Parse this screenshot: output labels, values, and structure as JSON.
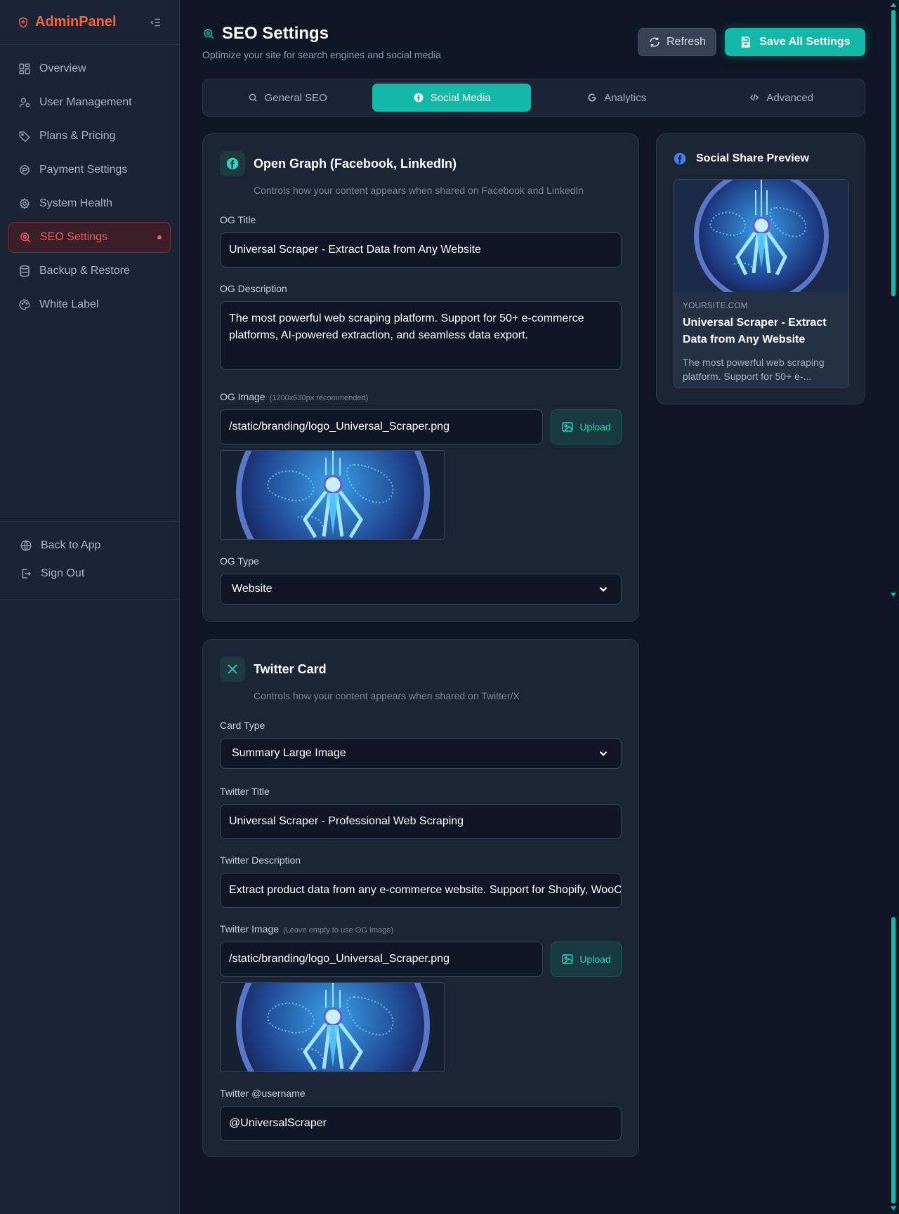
{
  "brand": {
    "name": "AdminPanel"
  },
  "sidebar": {
    "items": [
      {
        "label": "Overview"
      },
      {
        "label": "User Management"
      },
      {
        "label": "Plans & Pricing"
      },
      {
        "label": "Payment Settings"
      },
      {
        "label": "System Health"
      },
      {
        "label": "SEO Settings"
      },
      {
        "label": "Backup & Restore"
      },
      {
        "label": "White Label"
      }
    ],
    "footer": [
      {
        "label": "Back to App"
      },
      {
        "label": "Sign Out"
      }
    ]
  },
  "header": {
    "title": "SEO Settings",
    "subtitle": "Optimize your site for search engines and social media",
    "refresh_label": "Refresh",
    "save_label": "Save All Settings"
  },
  "tabs": [
    {
      "label": "General SEO"
    },
    {
      "label": "Social Media"
    },
    {
      "label": "Analytics"
    },
    {
      "label": "Advanced"
    }
  ],
  "open_graph": {
    "title": "Open Graph (Facebook, LinkedIn)",
    "description": "Controls how your content appears when shared on Facebook and LinkedIn",
    "og_title_label": "OG Title",
    "og_title_value": "Universal Scraper - Extract Data from Any Website",
    "og_description_label": "OG Description",
    "og_description_value": "The most powerful web scraping platform. Support for 50+ e-commerce platforms, AI-powered extraction, and seamless data export.",
    "og_image_label": "OG Image",
    "og_image_hint": "(1200x630px recommended)",
    "og_image_value": "/static/branding/logo_Universal_Scraper.png",
    "upload_label": "Upload",
    "og_type_label": "OG Type",
    "og_type_value": "Website"
  },
  "twitter": {
    "title": "Twitter Card",
    "description": "Controls how your content appears when shared on Twitter/X",
    "card_type_label": "Card Type",
    "card_type_value": "Summary Large Image",
    "twitter_title_label": "Twitter Title",
    "twitter_title_value": "Universal Scraper - Professional Web Scraping",
    "twitter_description_label": "Twitter Description",
    "twitter_description_value": "Extract product data from any e-commerce website. Support for Shopify, WooCommerce",
    "twitter_image_label": "Twitter Image",
    "twitter_image_hint": "(Leave empty to use OG Image)",
    "twitter_image_value": "/static/branding/logo_Universal_Scraper.png",
    "upload_label": "Upload",
    "username_label": "Twitter @username",
    "username_value": "@UniversalScraper"
  },
  "preview": {
    "title": "Social Share Preview",
    "domain": "YOURSITE.COM",
    "name": "Universal Scraper - Extract Data from Any Website",
    "text": "The most powerful web scraping platform. Support for 50+ e-..."
  },
  "colors": {
    "accent": "#14b8a6",
    "brand": "#f2683c",
    "active_nav": "#f05a5a",
    "background": "#0f1626",
    "card": "#1b2535"
  }
}
